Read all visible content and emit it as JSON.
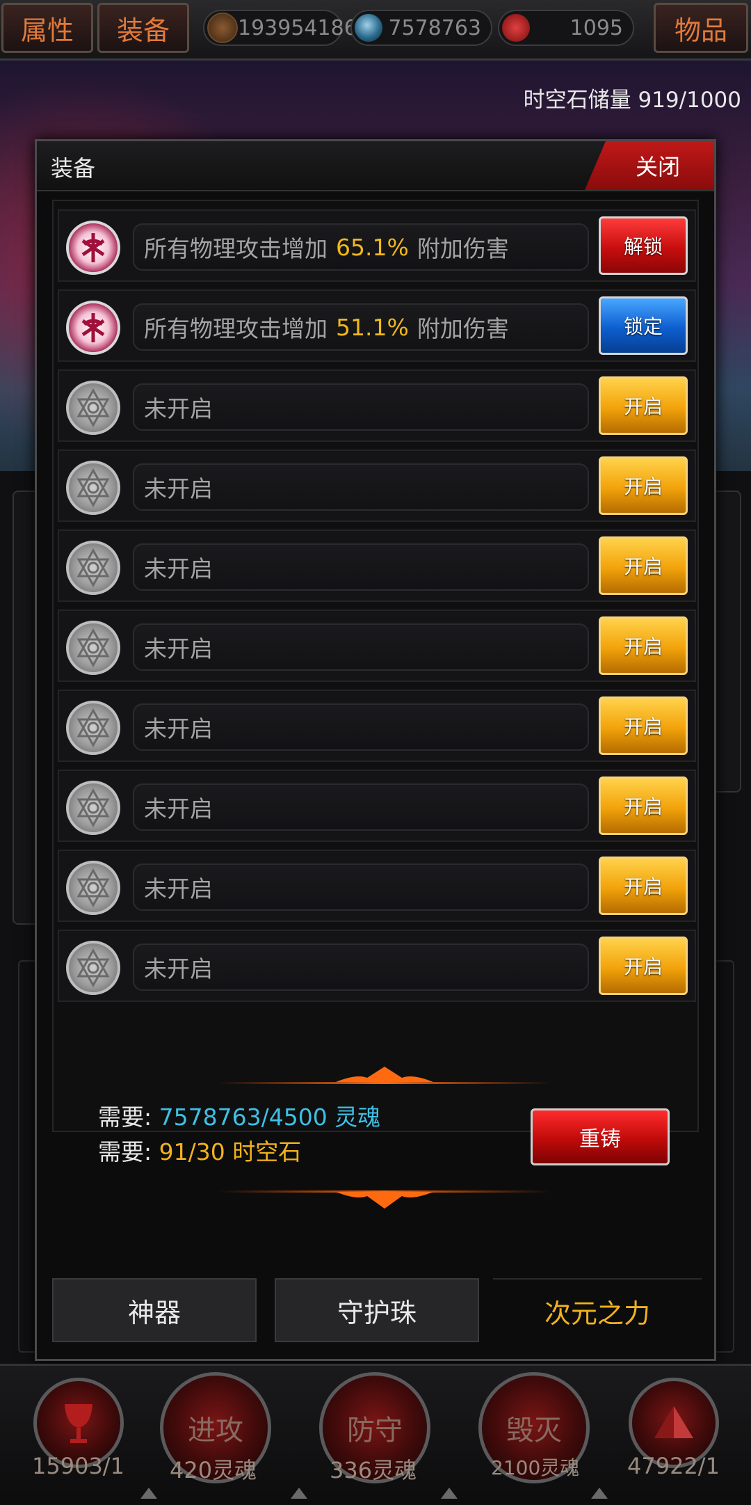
{
  "topbar": {
    "tab_left_1": "属性",
    "tab_left_2": "装备",
    "tab_right": "物品",
    "resources": [
      {
        "icon": "bronze-medal-icon",
        "value": "193954186"
      },
      {
        "icon": "skull-soul-icon",
        "value": "7578763"
      },
      {
        "icon": "red-gem-icon",
        "value": "1095"
      }
    ]
  },
  "scene": {
    "storage_text": "时空石储量 919/1000"
  },
  "dialog": {
    "title": "装备",
    "close_label": "关闭",
    "rows": [
      {
        "emblem": "active",
        "prefix": "所有物理攻击增加",
        "pct": "65.1%",
        "suffix": "附加伤害",
        "action": "解锁",
        "style": "red"
      },
      {
        "emblem": "active",
        "prefix": "所有物理攻击增加",
        "pct": "51.1%",
        "suffix": "附加伤害",
        "action": "锁定",
        "style": "blue"
      },
      {
        "emblem": "inactive",
        "prefix": "未开启",
        "pct": "",
        "suffix": "",
        "action": "开启",
        "style": "gold"
      },
      {
        "emblem": "inactive",
        "prefix": "未开启",
        "pct": "",
        "suffix": "",
        "action": "开启",
        "style": "gold"
      },
      {
        "emblem": "inactive",
        "prefix": "未开启",
        "pct": "",
        "suffix": "",
        "action": "开启",
        "style": "gold"
      },
      {
        "emblem": "inactive",
        "prefix": "未开启",
        "pct": "",
        "suffix": "",
        "action": "开启",
        "style": "gold"
      },
      {
        "emblem": "inactive",
        "prefix": "未开启",
        "pct": "",
        "suffix": "",
        "action": "开启",
        "style": "gold"
      },
      {
        "emblem": "inactive",
        "prefix": "未开启",
        "pct": "",
        "suffix": "",
        "action": "开启",
        "style": "gold"
      },
      {
        "emblem": "inactive",
        "prefix": "未开启",
        "pct": "",
        "suffix": "",
        "action": "开启",
        "style": "gold"
      },
      {
        "emblem": "inactive",
        "prefix": "未开启",
        "pct": "",
        "suffix": "",
        "action": "开启",
        "style": "gold"
      }
    ],
    "requirements": {
      "label": "需要:",
      "souls_value": "7578763/4500 灵魂",
      "stone_value": "91/30 时空石"
    },
    "reforge_label": "重铸",
    "tabs": [
      {
        "label": "神器",
        "active": false
      },
      {
        "label": "守护珠",
        "active": false
      },
      {
        "label": "次元之力",
        "active": true
      }
    ]
  },
  "bottom_bar": {
    "orbs": [
      {
        "icon": "goblet-icon",
        "label": "",
        "caption": "15903/1"
      },
      {
        "icon": "attack-orb-icon",
        "label": "进攻",
        "caption": "420灵魂"
      },
      {
        "icon": "defense-orb-icon",
        "label": "防守",
        "caption": "336灵魂"
      },
      {
        "icon": "destroy-orb-icon",
        "label": "毁灭",
        "caption": "2100灵魂"
      },
      {
        "icon": "pyramid-icon",
        "label": "",
        "caption": "47922/1"
      }
    ]
  }
}
